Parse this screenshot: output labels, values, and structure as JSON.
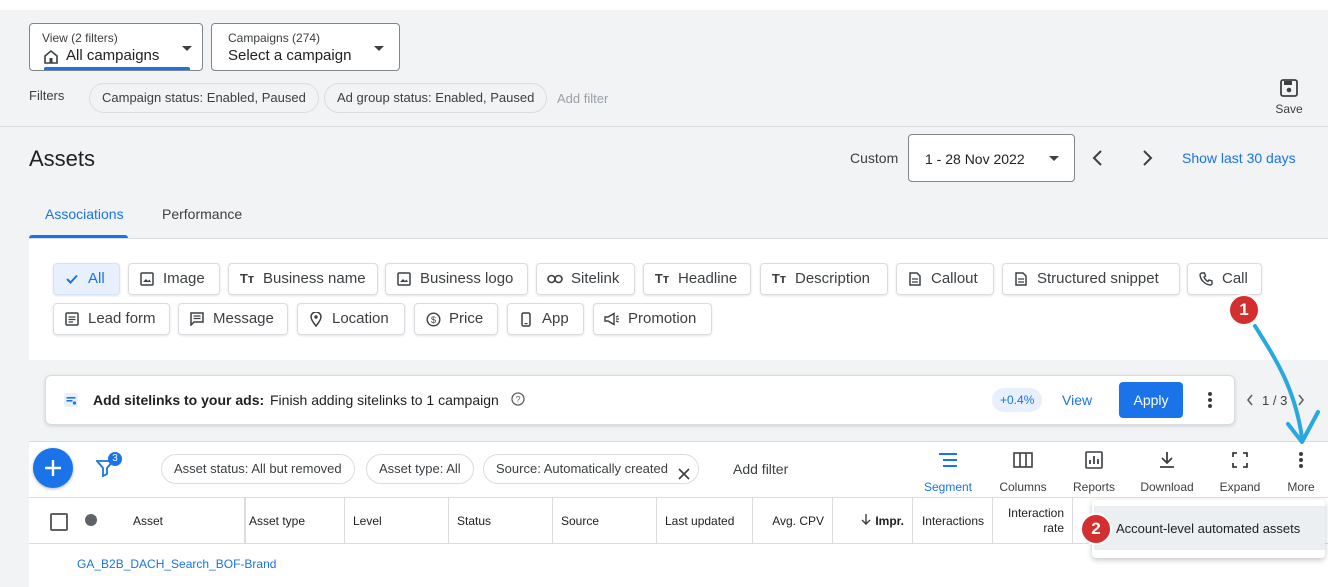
{
  "view_dropdown": {
    "label": "View (2 filters)",
    "value": "All campaigns"
  },
  "campaign_dropdown": {
    "label": "Campaigns (274)",
    "value": "Select a campaign"
  },
  "filters": {
    "label": "Filters",
    "chips": [
      "Campaign status: Enabled, Paused",
      "Ad group status: Enabled, Paused"
    ],
    "add_filter": "Add filter"
  },
  "save": {
    "label": "Save"
  },
  "page": {
    "title": "Assets"
  },
  "date": {
    "custom_label": "Custom",
    "range": "1 - 28 Nov 2022",
    "show_last": "Show last 30 days"
  },
  "tabs": [
    "Associations",
    "Performance"
  ],
  "asset_types": [
    {
      "label": "All",
      "icon": "check-icon"
    },
    {
      "label": "Image",
      "icon": "image-icon"
    },
    {
      "label": "Business name",
      "icon": "text-icon"
    },
    {
      "label": "Business logo",
      "icon": "image-icon"
    },
    {
      "label": "Sitelink",
      "icon": "link-icon"
    },
    {
      "label": "Headline",
      "icon": "text-icon"
    },
    {
      "label": "Description",
      "icon": "text-icon"
    },
    {
      "label": "Callout",
      "icon": "doc-icon"
    },
    {
      "label": "Structured snippet",
      "icon": "doc-icon"
    },
    {
      "label": "Call",
      "icon": "phone-icon"
    },
    {
      "label": "Lead form",
      "icon": "form-icon"
    },
    {
      "label": "Message",
      "icon": "message-icon"
    },
    {
      "label": "Location",
      "icon": "pin-icon"
    },
    {
      "label": "Price",
      "icon": "dollar-icon"
    },
    {
      "label": "App",
      "icon": "phone-device-icon"
    },
    {
      "label": "Promotion",
      "icon": "megaphone-icon"
    }
  ],
  "recommendation": {
    "title": "Add sitelinks to your ads:",
    "text": "Finish adding sitelinks to 1 campaign",
    "badge": "+0.4%",
    "view": "View",
    "apply": "Apply",
    "pager": "1 / 3"
  },
  "table_filter_count": "3",
  "table_chips": [
    "Asset status: All but removed",
    "Asset type: All",
    "Source: Automatically created"
  ],
  "table_add_filter": "Add filter",
  "toolbar": [
    "Segment",
    "Columns",
    "Reports",
    "Download",
    "Expand",
    "More"
  ],
  "columns": [
    "Asset",
    "Asset type",
    "Level",
    "Status",
    "Source",
    "Last updated",
    "Avg. CPV",
    "Impr.",
    "Interactions",
    "Interaction",
    "rate"
  ],
  "rows": [
    {
      "asset": "GA_B2B_DACH_Search_BOF-Brand"
    }
  ],
  "menu": {
    "item": "Account-level automated assets"
  },
  "callouts": [
    "1",
    "2"
  ],
  "colors": {
    "blue": "#1a73e8",
    "callout_red": "#d32f2f",
    "arrow": "#29a8e0"
  }
}
